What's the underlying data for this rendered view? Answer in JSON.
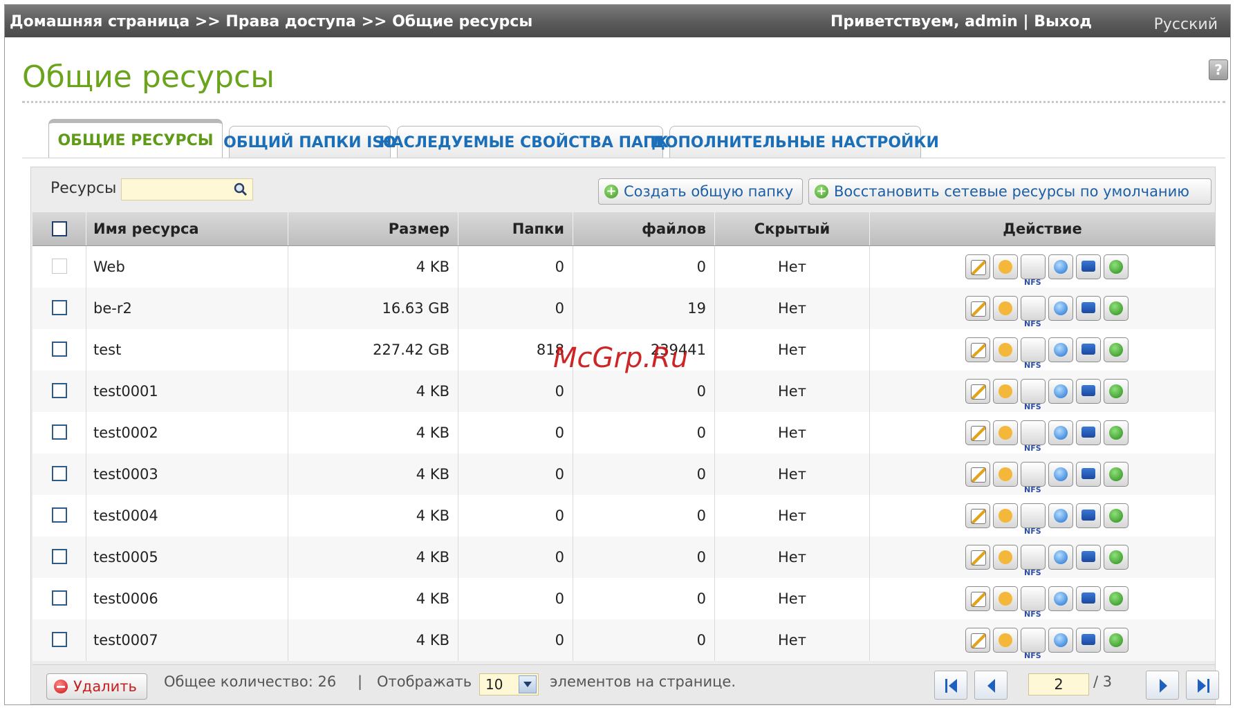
{
  "topbar": {
    "breadcrumb": [
      "Домашняя страница",
      "Права доступа",
      "Общие ресурсы"
    ],
    "separator": ">>",
    "greeting": "Приветствуем,",
    "user": "admin",
    "divider": "|",
    "logout": "Выход",
    "language": "Русский"
  },
  "help": "?",
  "page_title": "Общие ресурсы",
  "tabs": [
    {
      "label": "ОБЩИЕ РЕСУРСЫ",
      "active": true
    },
    {
      "label": "ОБЩИЙ ПАПКИ ISO",
      "active": false
    },
    {
      "label": "НАСЛЕДУЕМЫЕ СВОЙСТВА ПАПКИ",
      "active": false
    },
    {
      "label": "ДОПОЛНИТЕЛЬНЫЕ НАСТРОЙКИ",
      "active": false
    }
  ],
  "toolbar": {
    "search_label": "Ресурсы",
    "search_value": "",
    "create_button": "Создать общую папку",
    "restore_button": "Восстановить сетевые ресурсы по умолчанию"
  },
  "table": {
    "headers": {
      "name": "Имя ресурса",
      "size": "Размер",
      "folders": "Папки",
      "files": "файлов",
      "hidden": "Скрытый",
      "action": "Действие"
    },
    "rows": [
      {
        "name": "Web",
        "size": "4 KB",
        "folders": "0",
        "files": "0",
        "hidden": "Нет",
        "checkbox_disabled": true
      },
      {
        "name": "be-r2",
        "size": "16.63 GB",
        "folders": "0",
        "files": "19",
        "hidden": "Нет",
        "checkbox_disabled": false
      },
      {
        "name": "test",
        "size": "227.42 GB",
        "folders": "818",
        "files": "239441",
        "hidden": "Нет",
        "checkbox_disabled": false
      },
      {
        "name": "test0001",
        "size": "4 KB",
        "folders": "0",
        "files": "0",
        "hidden": "Нет",
        "checkbox_disabled": false
      },
      {
        "name": "test0002",
        "size": "4 KB",
        "folders": "0",
        "files": "0",
        "hidden": "Нет",
        "checkbox_disabled": false
      },
      {
        "name": "test0003",
        "size": "4 KB",
        "folders": "0",
        "files": "0",
        "hidden": "Нет",
        "checkbox_disabled": false
      },
      {
        "name": "test0004",
        "size": "4 KB",
        "folders": "0",
        "files": "0",
        "hidden": "Нет",
        "checkbox_disabled": false
      },
      {
        "name": "test0005",
        "size": "4 KB",
        "folders": "0",
        "files": "0",
        "hidden": "Нет",
        "checkbox_disabled": false
      },
      {
        "name": "test0006",
        "size": "4 KB",
        "folders": "0",
        "files": "0",
        "hidden": "Нет",
        "checkbox_disabled": false
      },
      {
        "name": "test0007",
        "size": "4 KB",
        "folders": "0",
        "files": "0",
        "hidden": "Нет",
        "checkbox_disabled": false
      }
    ],
    "action_icons": [
      "edit-icon",
      "permissions-icon",
      "nfs-icon",
      "globe-icon",
      "monitor-icon",
      "refresh-icon"
    ]
  },
  "footer": {
    "delete_button": "Удалить",
    "total_text": "Общее количество: 26",
    "divider": "|",
    "display_label": "Отображать",
    "per_page": "10",
    "per_page_suffix": "элементов на странице.",
    "current_page": "2",
    "total_pages": "/ 3"
  },
  "watermark": "McGrp.Ru",
  "colors": {
    "title_green": "#6aa41d",
    "tab_blue": "#1b6fb8",
    "delete_red": "#c31f1f"
  }
}
